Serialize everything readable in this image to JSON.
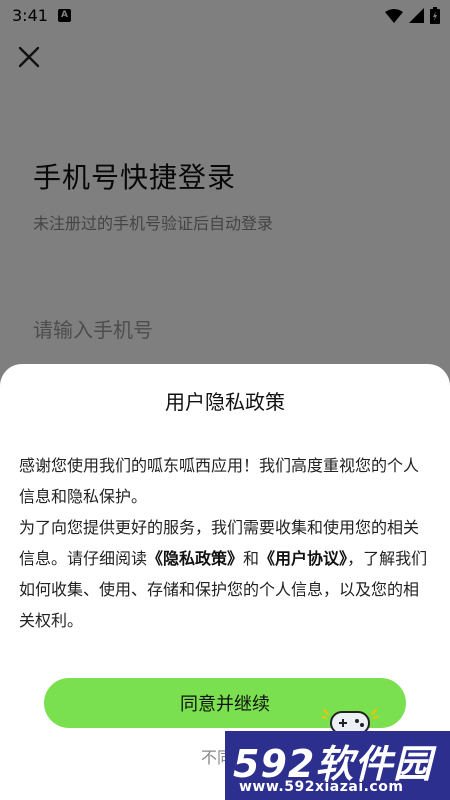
{
  "status_bar": {
    "time": "3:41",
    "notification_letter": "A"
  },
  "login": {
    "title": "手机号快捷登录",
    "subtitle": "未注册过的手机号验证后自动登录",
    "phone_placeholder": "请输入手机号"
  },
  "privacy_sheet": {
    "title": "用户隐私政策",
    "para1": "感谢您使用我们的呱东呱西应用！我们高度重视您的个人信息和隐私保护。",
    "para2_start": "为了向您提供更好的服务，我们需要收集和使用您的相关信息。请仔细阅读",
    "privacy_link": "《隐私政策》",
    "and_word": "和",
    "user_agreement_link": "《用户协议》",
    "para2_end": "，了解我们如何收集、使用、存储和保护您的个人信息，以及您的相关权利。",
    "agree_button": "同意并继续",
    "disagree_link": "不同意"
  },
  "watermark": {
    "brand_number": "592",
    "brand_text": "软件园",
    "url": "www.592xiazai.com"
  },
  "colors": {
    "accent_green": "#7ae04f",
    "watermark_blue": "#2c2f8e"
  }
}
